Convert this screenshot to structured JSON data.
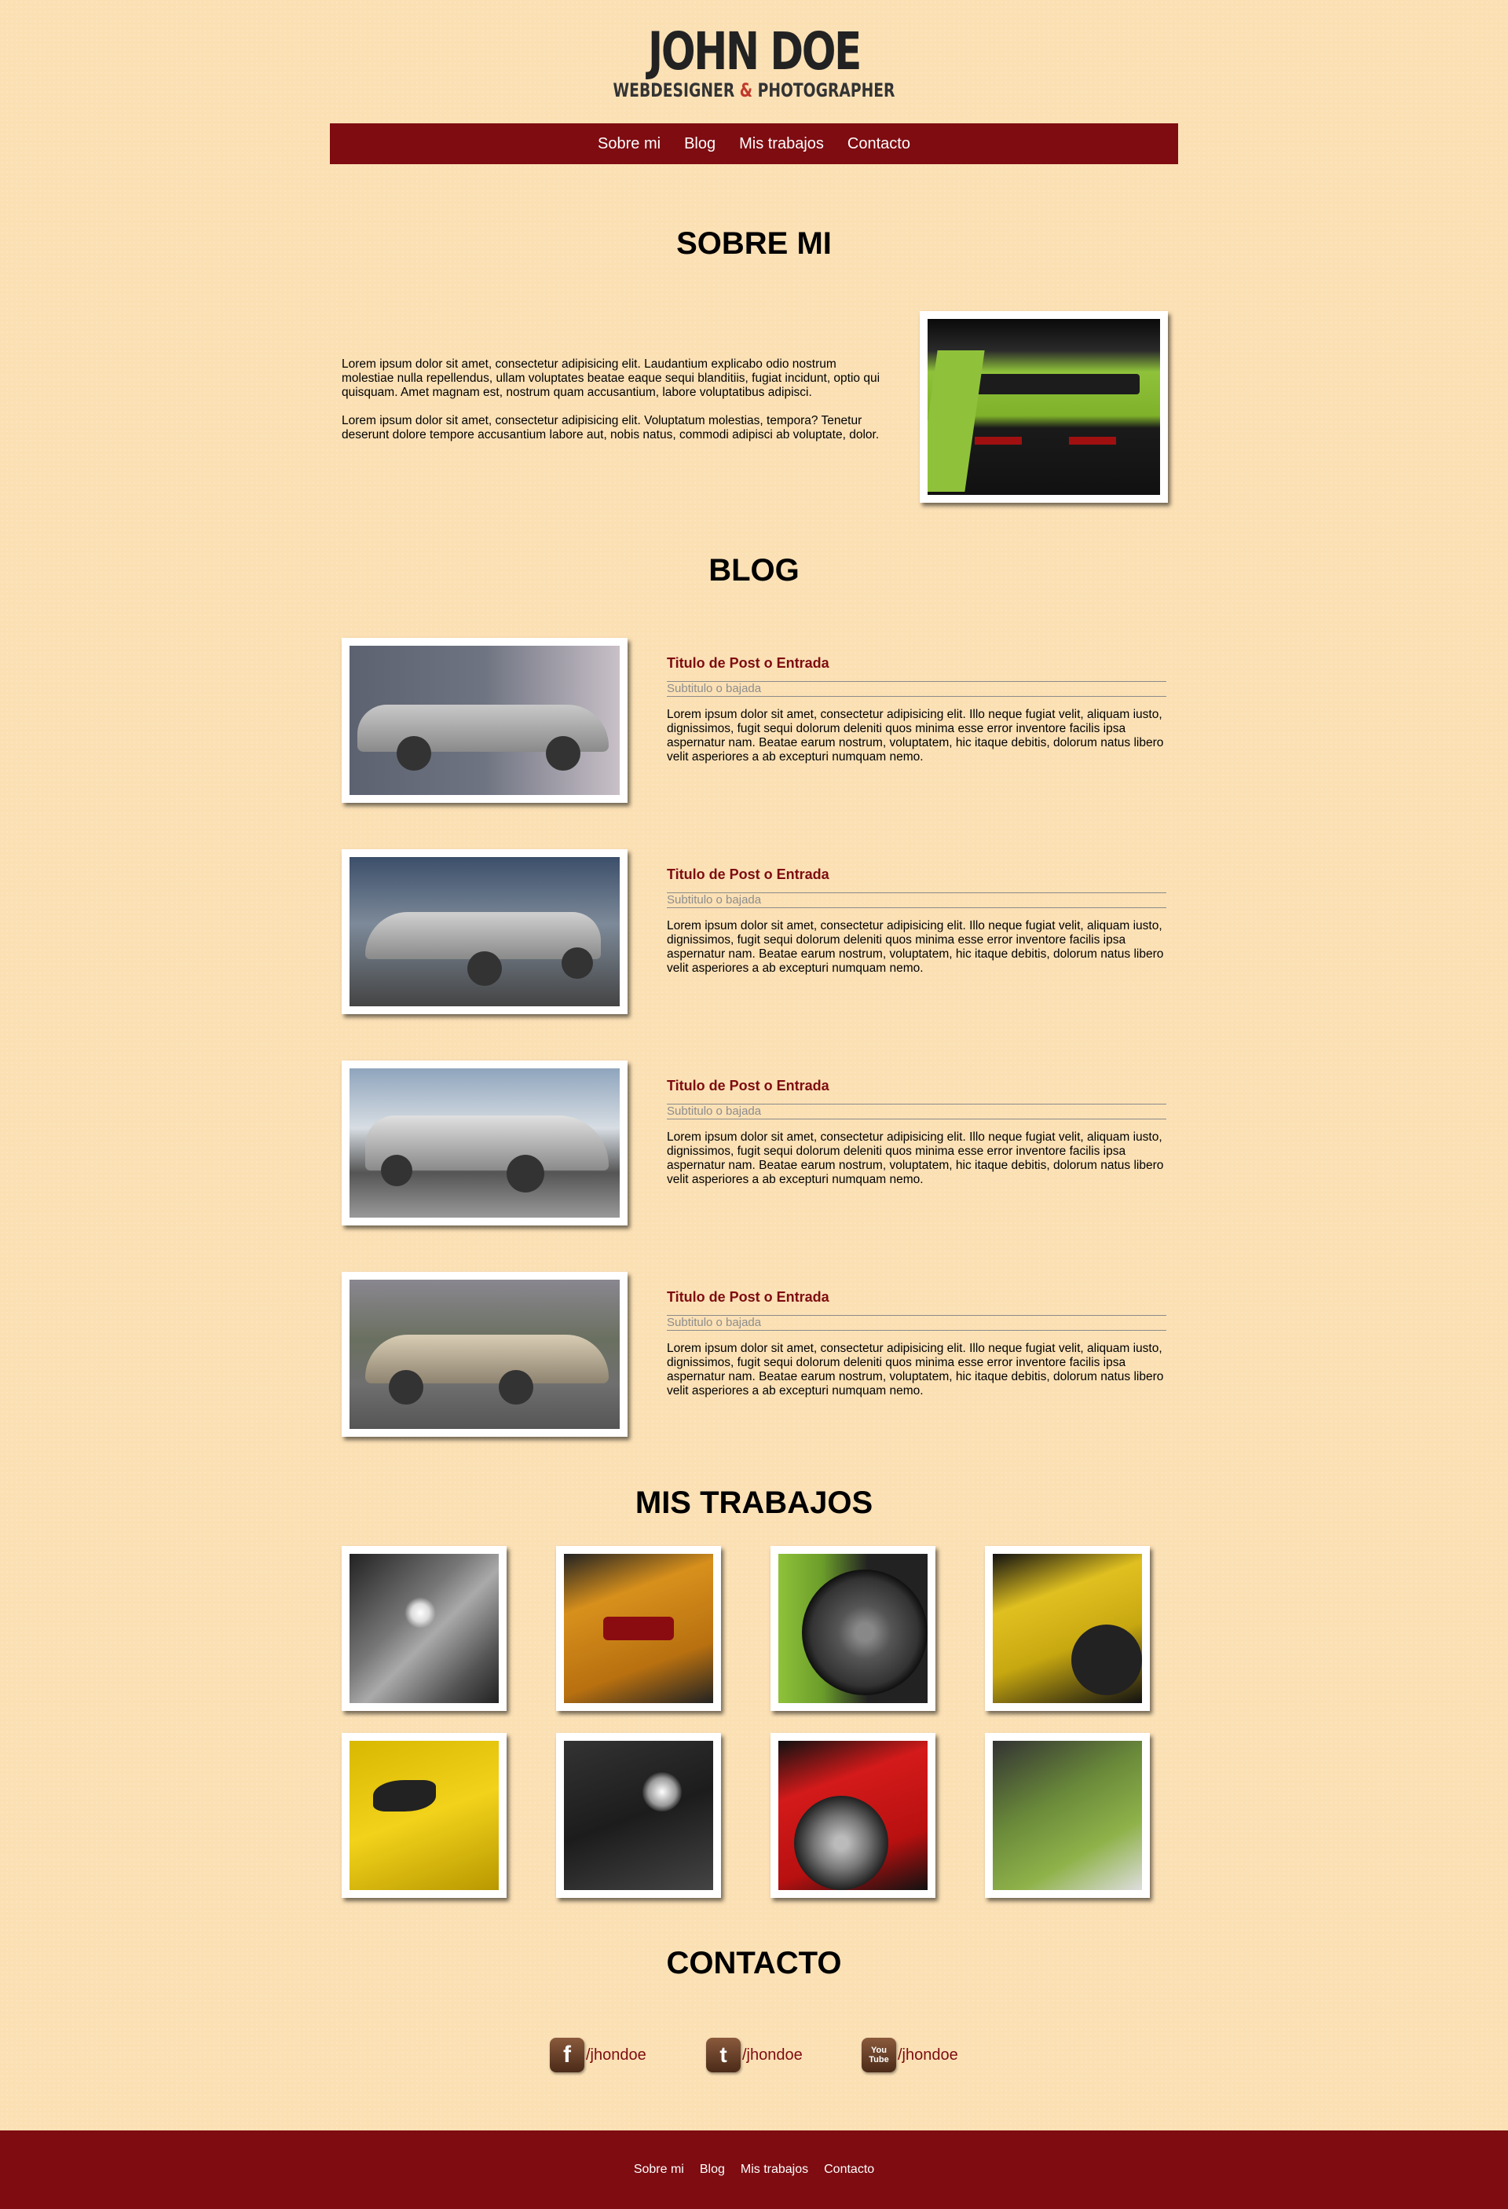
{
  "logo": {
    "name": "JOHN DOE",
    "tag_before": "WEBDESIGNER ",
    "tag_amp": "&",
    "tag_after": " PHOTOGRAPHER"
  },
  "nav": {
    "items": [
      "Sobre mi",
      "Blog",
      "Mis trabajos",
      "Contacto"
    ]
  },
  "about": {
    "title": "SOBRE MI",
    "paragraphs": [
      "Lorem ipsum dolor sit amet, consectetur adipisicing elit. Laudantium explicabo odio nostrum molestiae nulla repellendus, ullam voluptates beatae eaque sequi blanditiis, fugiat incidunt, optio qui quisquam. Amet magnam est, nostrum quam accusantium, labore voluptatibus adipisci.",
      "Lorem ipsum dolor sit amet, consectetur adipisicing elit. Voluptatum molestias, tempora? Tenetur deserunt dolore tempore accusantium labore aut, nobis natus, commodi adipisci ab voluptate, dolor."
    ]
  },
  "blog": {
    "title": "BLOG",
    "posts": [
      {
        "title": "Titulo de Post o Entrada",
        "subtitle": "Subtitulo o bajada",
        "body": "Lorem ipsum dolor sit amet, consectetur adipisicing elit. Illo neque fugiat velit, aliquam iusto, dignissimos, fugit sequi dolorum deleniti quos minima esse error inventore facilis ipsa aspernatur nam. Beatae earum nostrum, voluptatem, hic itaque debitis, dolorum natus libero velit asperiores a ab excepturi numquam nemo."
      },
      {
        "title": "Titulo de Post o Entrada",
        "subtitle": "Subtitulo o bajada",
        "body": "Lorem ipsum dolor sit amet, consectetur adipisicing elit. Illo neque fugiat velit, aliquam iusto, dignissimos, fugit sequi dolorum deleniti quos minima esse error inventore facilis ipsa aspernatur nam. Beatae earum nostrum, voluptatem, hic itaque debitis, dolorum natus libero velit asperiores a ab excepturi numquam nemo."
      },
      {
        "title": "Titulo de Post o Entrada",
        "subtitle": "Subtitulo o bajada",
        "body": "Lorem ipsum dolor sit amet, consectetur adipisicing elit. Illo neque fugiat velit, aliquam iusto, dignissimos, fugit sequi dolorum deleniti quos minima esse error inventore facilis ipsa aspernatur nam. Beatae earum nostrum, voluptatem, hic itaque debitis, dolorum natus libero velit asperiores a ab excepturi numquam nemo."
      },
      {
        "title": "Titulo de Post o Entrada",
        "subtitle": "Subtitulo o bajada",
        "body": "Lorem ipsum dolor sit amet, consectetur adipisicing elit. Illo neque fugiat velit, aliquam iusto, dignissimos, fugit sequi dolorum deleniti quos minima esse error inventore facilis ipsa aspernatur nam. Beatae earum nostrum, voluptatem, hic itaque debitis, dolorum natus libero velit asperiores a ab excepturi numquam nemo."
      }
    ]
  },
  "works": {
    "title": "MIS TRABAJOS"
  },
  "contact": {
    "title": "CONTACTO",
    "links": [
      {
        "icon": "facebook-icon",
        "glyph": "f",
        "handle": "/jhondoe"
      },
      {
        "icon": "twitter-icon",
        "glyph": "t",
        "handle": "/jhondoe"
      },
      {
        "icon": "youtube-icon",
        "glyph": "You Tube",
        "handle": "/jhondoe"
      }
    ]
  },
  "footer": {
    "items": [
      "Sobre mi",
      "Blog",
      "Mis trabajos",
      "Contacto"
    ]
  },
  "colors": {
    "brand": "#7e0c11",
    "background": "#fbe0b4"
  }
}
